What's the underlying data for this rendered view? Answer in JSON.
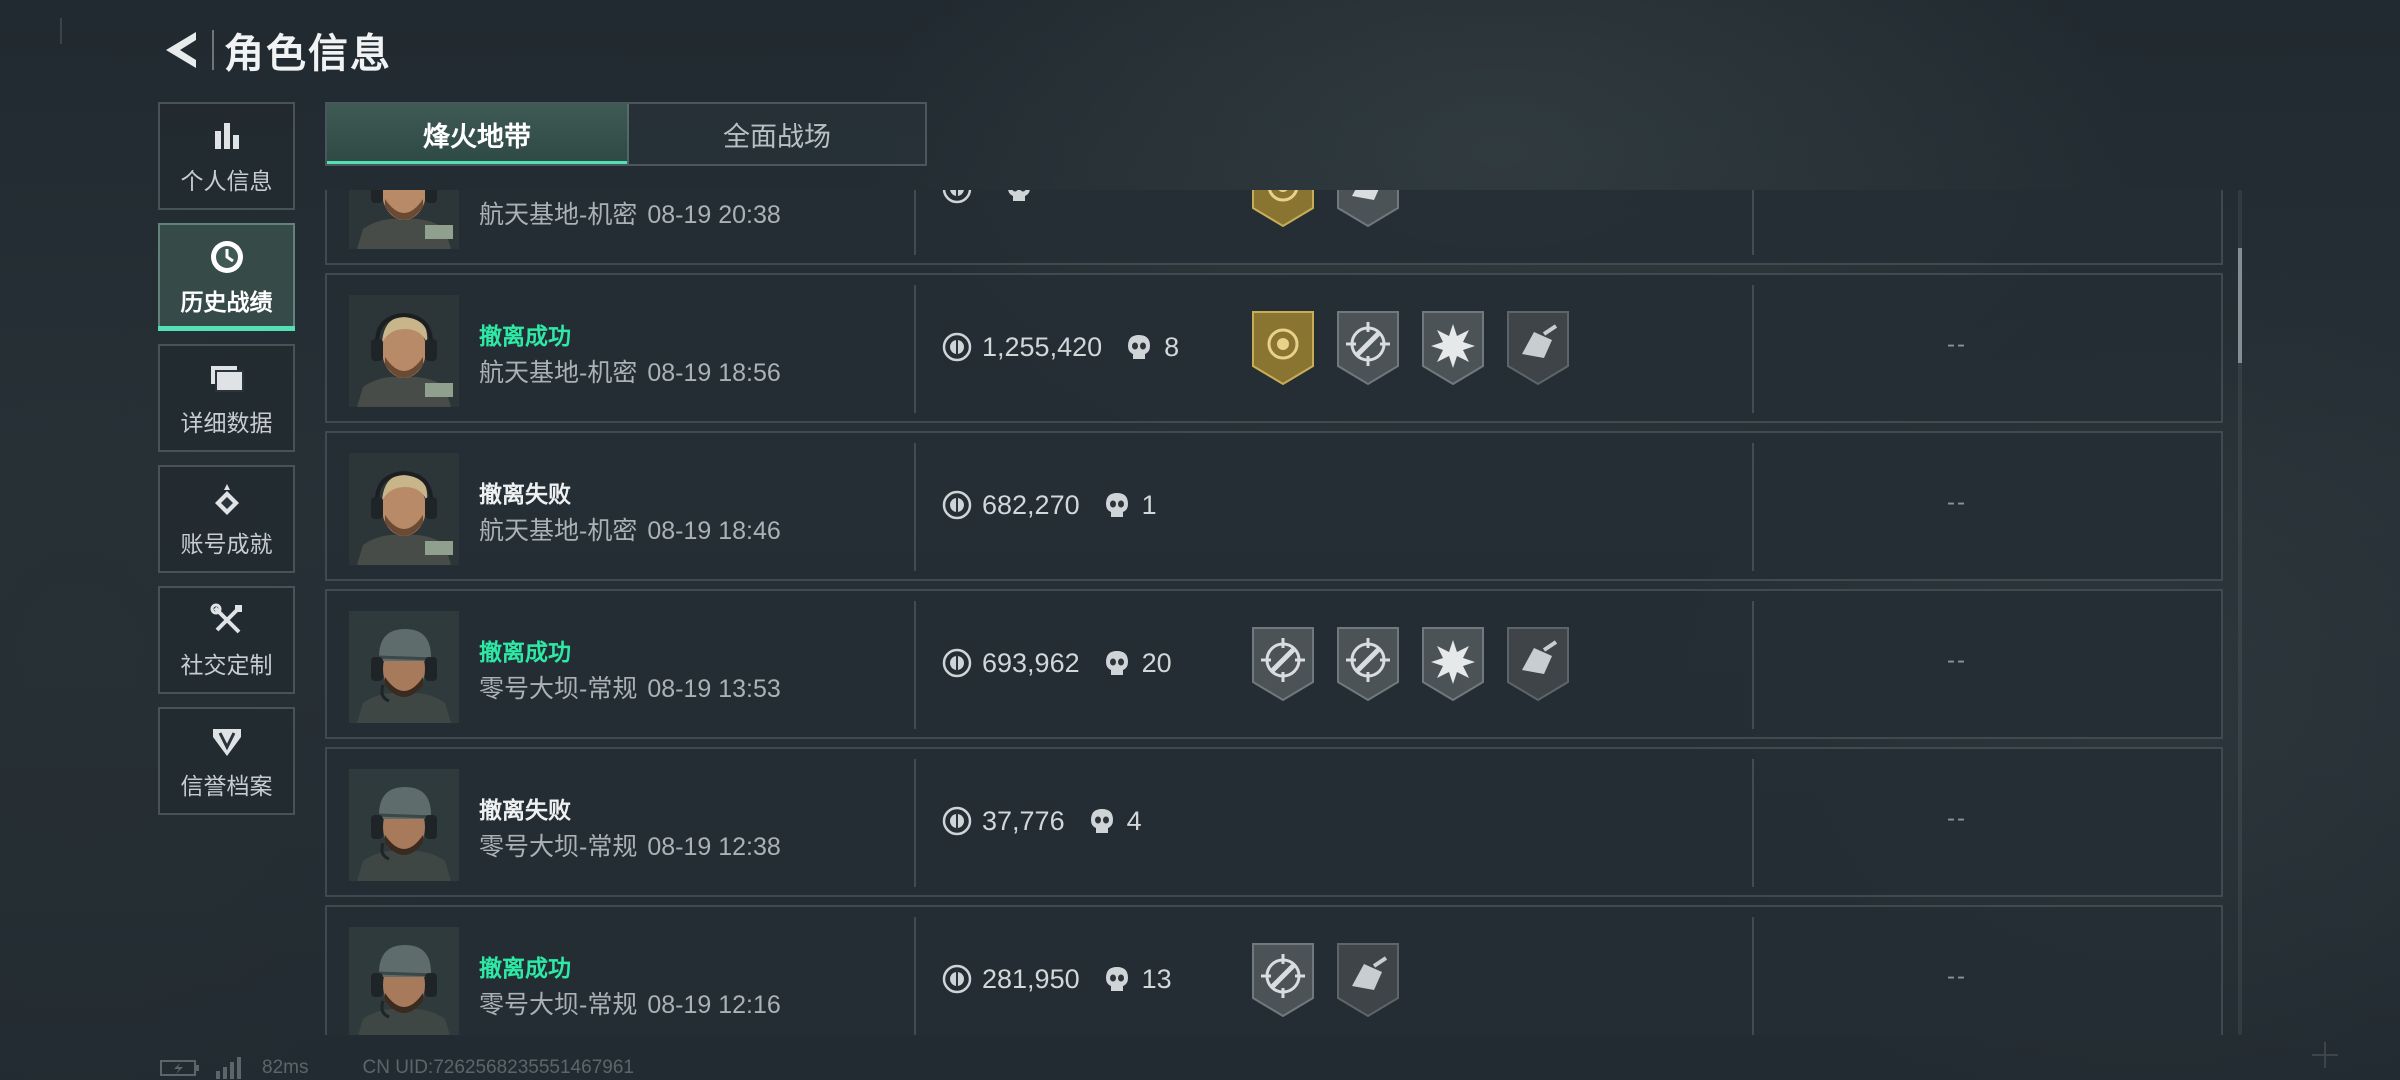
{
  "header": {
    "title": "角色信息"
  },
  "sidebar": {
    "items": [
      {
        "label": "个人信息",
        "icon": "bar-chart-icon"
      },
      {
        "label": "历史战绩",
        "icon": "clock-icon"
      },
      {
        "label": "详细数据",
        "icon": "folder-icon"
      },
      {
        "label": "账号成就",
        "icon": "achievement-icon"
      },
      {
        "label": "社交定制",
        "icon": "tools-icon"
      },
      {
        "label": "信誉档案",
        "icon": "shield-icon"
      }
    ],
    "active_index": 1
  },
  "tabs": [
    {
      "label": "烽火地带",
      "active": true
    },
    {
      "label": "全面战场",
      "active": false
    }
  ],
  "records": [
    {
      "status": "",
      "map": "航天基地-机密",
      "time": "08-19 20:38",
      "value": "",
      "kills": "",
      "result": ""
    },
    {
      "status": "撤离成功",
      "map": "航天基地-机密",
      "time": "08-19 18:56",
      "value": "1,255,420",
      "kills": "8",
      "result": "--"
    },
    {
      "status": "撤离失败",
      "map": "航天基地-机密",
      "time": "08-19 18:46",
      "value": "682,270",
      "kills": "1",
      "result": "--"
    },
    {
      "status": "撤离成功",
      "map": "零号大坝-常规",
      "time": "08-19 13:53",
      "value": "693,962",
      "kills": "20",
      "result": "--"
    },
    {
      "status": "撤离失败",
      "map": "零号大坝-常规",
      "time": "08-19 12:38",
      "value": "37,776",
      "kills": "4",
      "result": "--"
    },
    {
      "status": "撤离成功",
      "map": "零号大坝-常规",
      "time": "08-19 12:16",
      "value": "281,950",
      "kills": "13",
      "result": "--"
    }
  ],
  "footer": {
    "ping": "82ms",
    "uid": "CN UID:7262568235551467961"
  },
  "colors": {
    "accent": "#52e0b4",
    "success": "#2ee8a6",
    "gold_badge": "#8a7432"
  }
}
